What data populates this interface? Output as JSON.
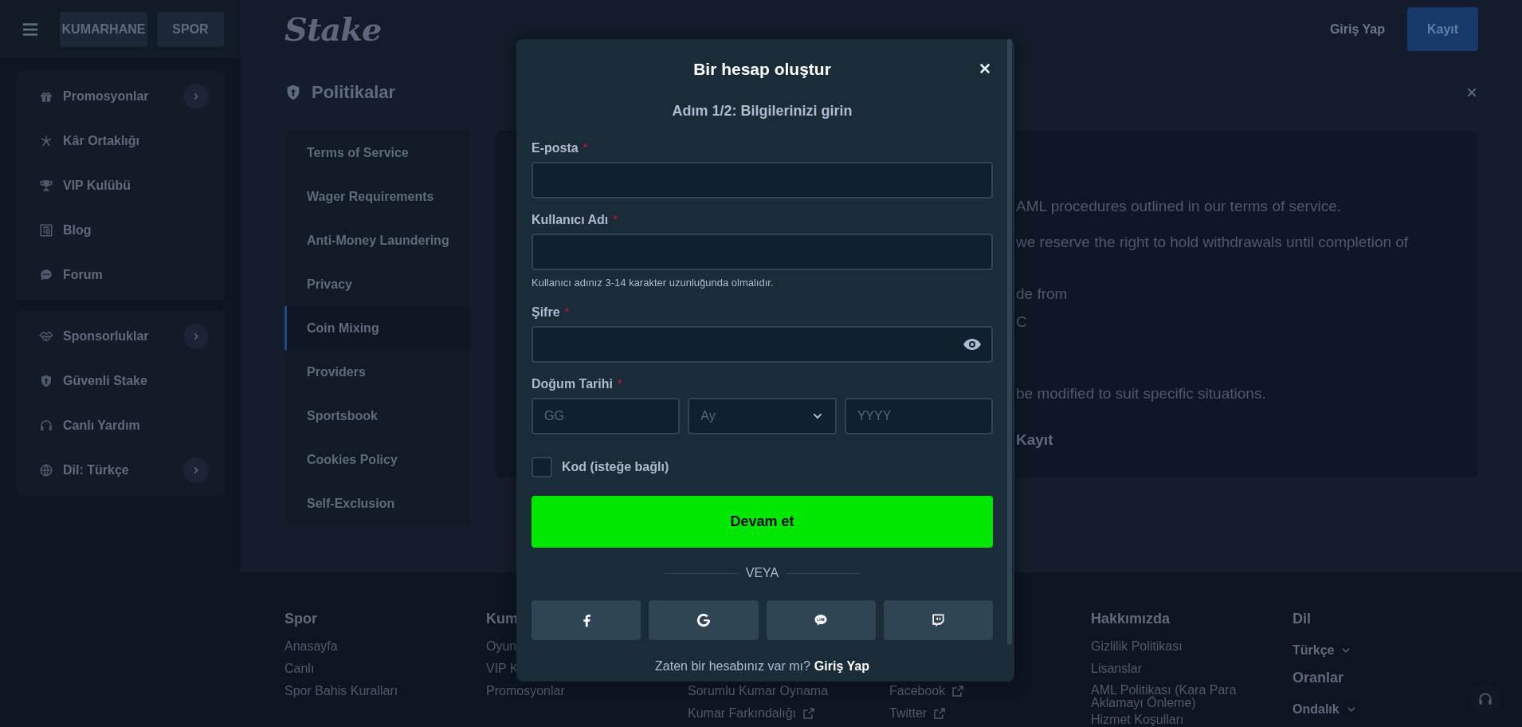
{
  "top_bar": {
    "tabs": [
      {
        "label": "KUMARHANE",
        "selected": false
      },
      {
        "label": "SPOR",
        "selected": false
      }
    ],
    "logo": "Stake",
    "login": "Giriş Yap",
    "register": "Kayıt"
  },
  "sidebar": {
    "groups": [
      {
        "items": [
          {
            "label": "Promosyonlar",
            "submenu": true
          },
          {
            "label": "Kâr Ortaklığı",
            "submenu": false
          },
          {
            "label": "VIP Kulübü",
            "submenu": false
          },
          {
            "label": "Blog",
            "submenu": false
          },
          {
            "label": "Forum",
            "submenu": false
          }
        ]
      },
      {
        "items": [
          {
            "label": "Sponsorluklar",
            "submenu": true
          },
          {
            "label": "Güvenli Stake",
            "submenu": false
          },
          {
            "label": "Canlı Yardım",
            "submenu": false
          },
          {
            "label": "Dil: Türkçe",
            "submenu": true
          }
        ]
      }
    ]
  },
  "policies": {
    "title": "Politikalar",
    "nav": [
      {
        "label": "Terms of Service",
        "selected": false
      },
      {
        "label": "Wager Requirements",
        "selected": false
      },
      {
        "label": "Anti-Money Laundering",
        "selected": false
      },
      {
        "label": "Privacy",
        "selected": false
      },
      {
        "label": "Coin Mixing",
        "selected": true
      },
      {
        "label": "Providers",
        "selected": false
      },
      {
        "label": "Sportsbook",
        "selected": false
      },
      {
        "label": "Cookies Policy",
        "selected": false
      },
      {
        "label": "Self-Exclusion",
        "selected": false
      }
    ],
    "content_fragments": [
      {
        "text": "AML procedures outlined in our terms of service.",
        "bold": false
      },
      {
        "text": "we reserve the right to hold withdrawals until completion of",
        "bold": false
      },
      {
        "text": "de from",
        "bold": false
      },
      {
        "text": "C",
        "bold": false
      },
      {
        "text": "be modified to suit specific situations.",
        "bold": false
      },
      {
        "text": "Kayıt",
        "bold": true
      }
    ]
  },
  "footer": {
    "columns": [
      {
        "items": [
          {
            "kind": "heading",
            "label": "Spor"
          },
          {
            "kind": "link",
            "label": "Anasayfa",
            "external": false
          },
          {
            "kind": "link",
            "label": "Canlı",
            "external": false
          },
          {
            "kind": "link",
            "label": "Spor Bahis Kuralları",
            "external": false
          }
        ]
      },
      {
        "items": [
          {
            "kind": "heading",
            "label": "Kum"
          },
          {
            "kind": "link",
            "label": "Oyun",
            "external": false
          },
          {
            "kind": "link",
            "label": "VIP K",
            "external": false
          },
          {
            "kind": "link",
            "label": "Promosyonlar",
            "external": false
          }
        ]
      },
      {
        "items": [
          {
            "kind": "link",
            "label": "Sorumlu Kumar Oynama",
            "external": false
          },
          {
            "kind": "link",
            "label": "Kumar Farkındalığı",
            "external": true
          }
        ]
      },
      {
        "items": [
          {
            "kind": "link",
            "label": "Facebook",
            "external": true
          },
          {
            "kind": "link",
            "label": "Twitter",
            "external": true
          }
        ]
      },
      {
        "items": [
          {
            "kind": "heading",
            "label": "Hakkımızda"
          },
          {
            "kind": "link",
            "label": "Gizlilik Politikası",
            "external": false
          },
          {
            "kind": "link",
            "label": "Lisanslar",
            "external": false
          },
          {
            "kind": "link",
            "label": "AML Politikası (Kara Para Aklamayı Önleme)",
            "external": false
          },
          {
            "kind": "link",
            "label": "Hizmet Koşulları",
            "external": false
          }
        ]
      },
      {
        "items": [
          {
            "kind": "heading",
            "label": "Dil"
          },
          {
            "kind": "dropdown",
            "label": "Türkçe"
          },
          {
            "kind": "heading",
            "label": "Oranlar"
          },
          {
            "kind": "dropdown",
            "label": "Ondalık"
          }
        ]
      }
    ]
  },
  "modal": {
    "title": "Bir hesap oluştur",
    "step": "Adım 1/2: Bilgilerinizi girin",
    "fields": [
      {
        "kind": "text",
        "label": "E-posta",
        "required_mark": "*"
      },
      {
        "kind": "text",
        "label": "Kullanıcı Adı",
        "required_mark": "*",
        "hint": "Kullanıcı adınız 3-14 karakter uzunluğunda olmalıdır."
      },
      {
        "kind": "password",
        "label": "Şifre",
        "required_mark": "*"
      },
      {
        "kind": "date",
        "label": "Doğum Tarihi",
        "required_mark": "*",
        "parts": [
          {
            "kind": "input",
            "placeholder": "GG"
          },
          {
            "kind": "select",
            "placeholder": "Ay"
          },
          {
            "kind": "input",
            "placeholder": "YYYY"
          }
        ]
      }
    ],
    "code_option": {
      "label": "Kod (isteğe bağlı)",
      "checked": false
    },
    "submit": "Devam et",
    "divider": "VEYA",
    "socials": [
      {
        "kind": "facebook"
      },
      {
        "kind": "google"
      },
      {
        "kind": "line"
      },
      {
        "kind": "twitch"
      }
    ],
    "login_prompt": "Zaten bir hesabınız var mı?",
    "login_link": "Giriş Yap"
  }
}
